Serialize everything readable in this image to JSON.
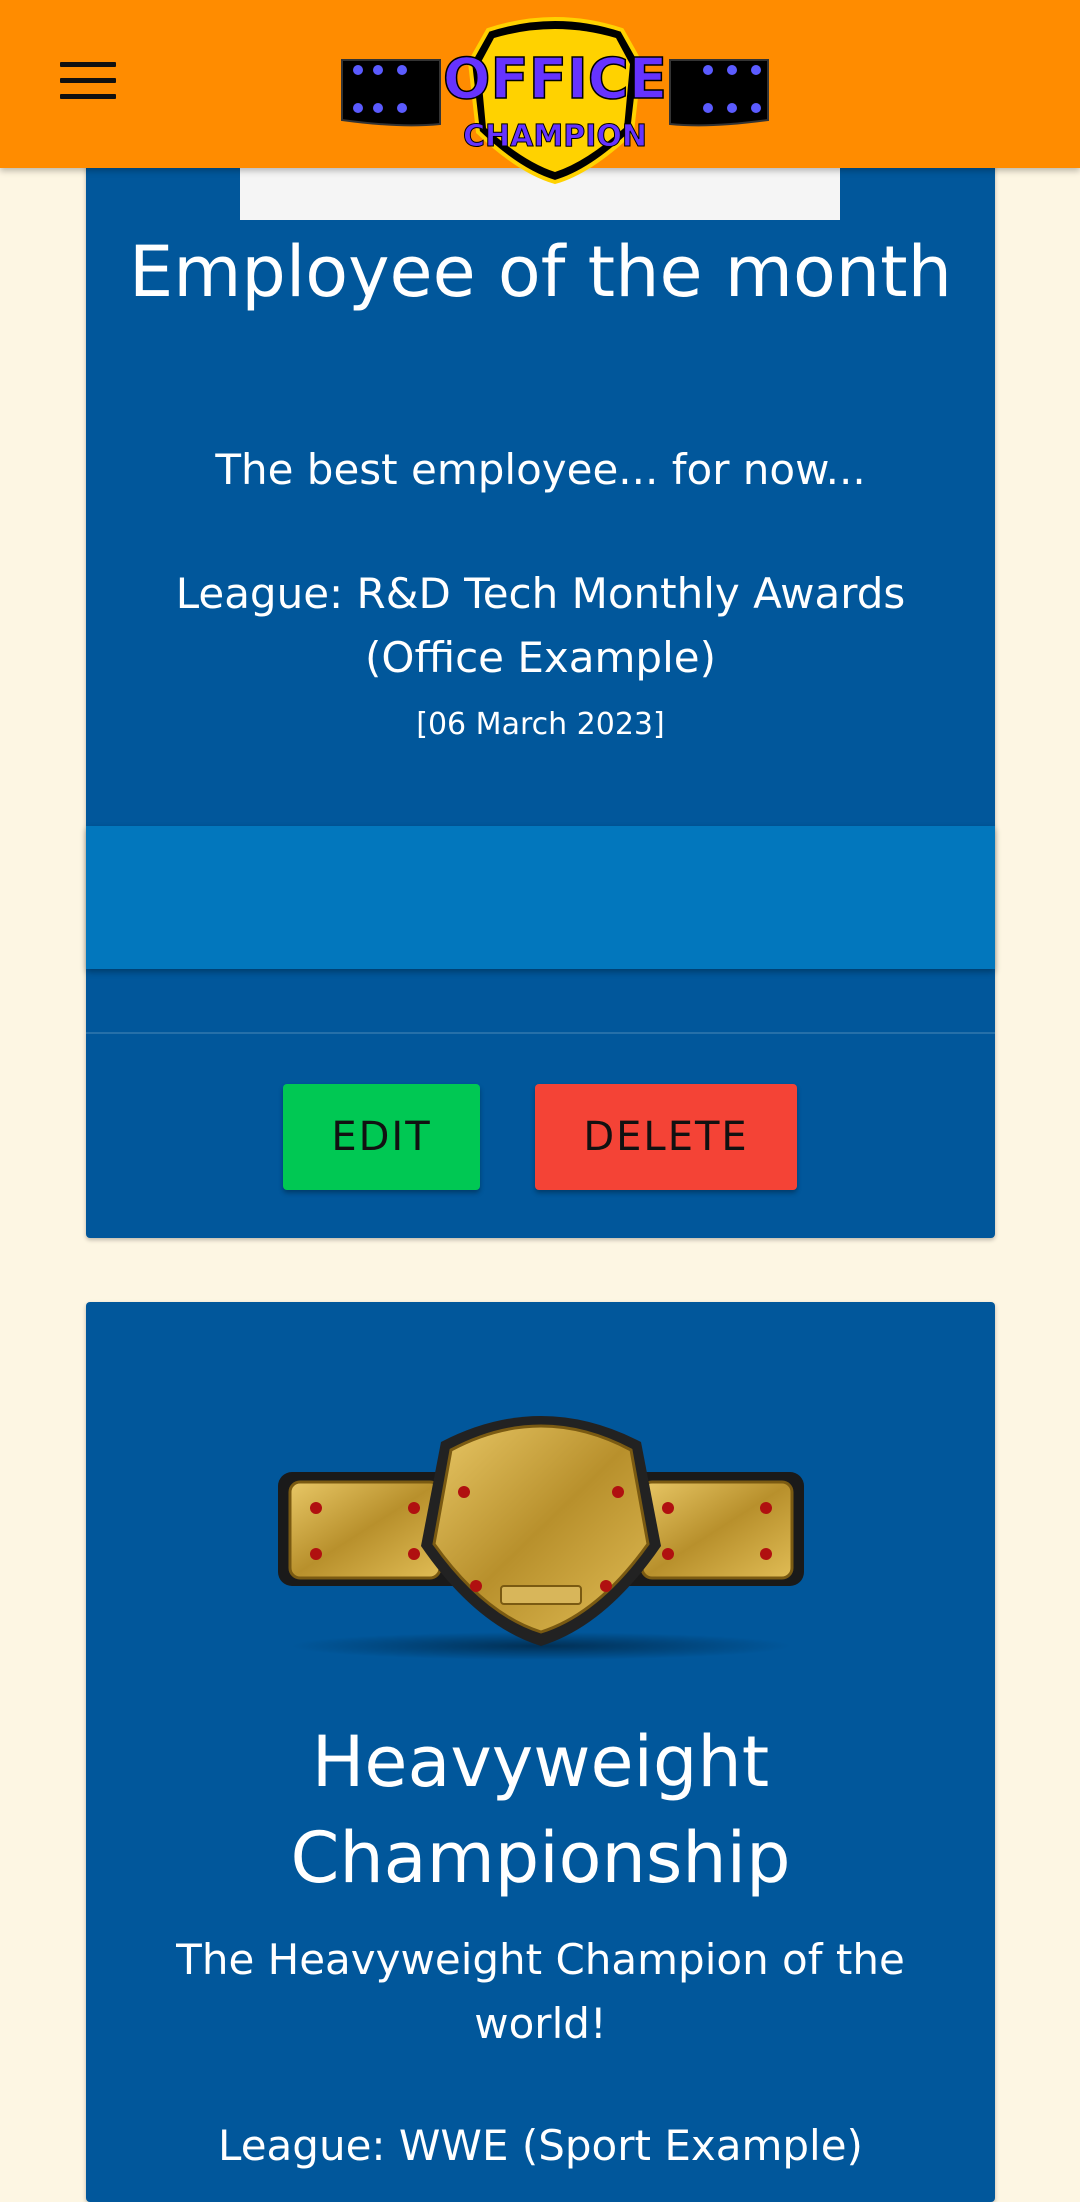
{
  "header": {
    "menu_icon": "hamburger-menu-icon",
    "logo": {
      "line1": "OFFICE",
      "line2": "CHAMPION"
    }
  },
  "colors": {
    "header_bg": "#ff8c00",
    "page_bg": "#fdf6e3",
    "card_bg": "#01579b",
    "champion_bar": "#0277bd",
    "edit_button": "#00c853",
    "delete_button": "#f44336"
  },
  "cards": [
    {
      "title": "Employee of the month",
      "description": "The best employee... for now...",
      "league": "League: R&D Tech Monthly Awards (Office Example)",
      "date": "[06 March 2023]",
      "edit_label": "EDIT",
      "delete_label": "DELETE"
    },
    {
      "title": "Heavyweight Championship",
      "description": "The Heavyweight Champion of the world!",
      "league": "League: WWE (Sport Example)"
    }
  ]
}
